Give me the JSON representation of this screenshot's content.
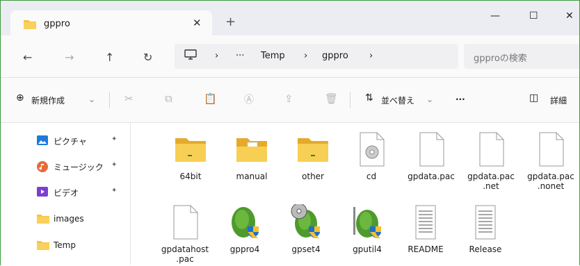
{
  "titlebar": {
    "tab_title": "gppro",
    "tab_close": "✕",
    "new_tab": "+",
    "minimize": "—",
    "maximize": "☐",
    "close": "✕"
  },
  "nav": {
    "back": "←",
    "forward": "→",
    "up": "↑",
    "refresh": "↻",
    "more": "···",
    "chevron": "›",
    "breadcrumb": [
      "Temp",
      "gppro"
    ],
    "search_placeholder": "gpproの検索"
  },
  "commands": {
    "new": "新規作成",
    "new_chevron": "⌄",
    "sort": "並べ替え",
    "sort_chevron": "⌄",
    "more": "···",
    "details": "詳細"
  },
  "sidebar": {
    "items": [
      {
        "label": "ピクチャ",
        "icon": "pictures-icon",
        "pinned": true
      },
      {
        "label": "ミュージック",
        "icon": "music-icon",
        "pinned": true
      },
      {
        "label": "ビデオ",
        "icon": "videos-icon",
        "pinned": true
      },
      {
        "label": "images",
        "icon": "folder-icon",
        "pinned": false
      },
      {
        "label": "Temp",
        "icon": "folder-icon",
        "pinned": false
      }
    ],
    "pin_glyph": "📌"
  },
  "files": [
    {
      "name": "64bit",
      "type": "folder"
    },
    {
      "name": "manual",
      "type": "folder"
    },
    {
      "name": "other",
      "type": "folder"
    },
    {
      "name": "cd",
      "type": "disc"
    },
    {
      "name": "gpdata.pac",
      "type": "file"
    },
    {
      "name": "gpdata.pac .net",
      "type": "file"
    },
    {
      "name": "gpdata.pac .nonet",
      "type": "file"
    },
    {
      "name": "gpdatahost .pac",
      "type": "file"
    },
    {
      "name": "gppro4",
      "type": "app"
    },
    {
      "name": "gpset4",
      "type": "app"
    },
    {
      "name": "gputil4",
      "type": "app"
    },
    {
      "name": "README",
      "type": "text"
    },
    {
      "name": "Release",
      "type": "text"
    }
  ],
  "colors": {
    "accent": "#0067c0",
    "folder": "#f5c342",
    "border": "#3a9a3a"
  }
}
